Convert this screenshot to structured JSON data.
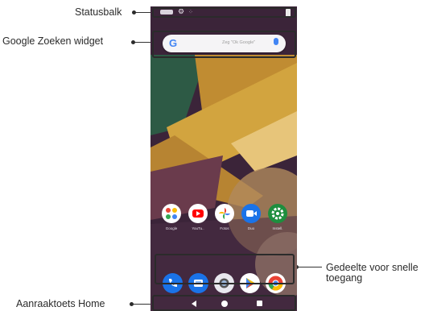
{
  "callouts": {
    "statusbar": "Statusbalk",
    "google_widget": "Google Zoeken widget",
    "quick_access": "Gedeelte voor snelle toegang",
    "home_touch_keys": "Aanraaktoets Home"
  },
  "search_widget": {
    "logo": "G",
    "placeholder": "Zeg \"Ok Google\""
  },
  "apps": [
    {
      "label": "Google",
      "icon": "google-folder-icon",
      "color": "#ffffff"
    },
    {
      "label": "YouTu..",
      "icon": "youtube-icon",
      "color": "#ff0000"
    },
    {
      "label": "Fotos",
      "icon": "google-photos-icon",
      "color": "#ffffff"
    },
    {
      "label": "Duo",
      "icon": "duo-icon",
      "color": "#1a73e8"
    },
    {
      "label": "Instell.",
      "icon": "settings-icon",
      "color": "#1e8e3e"
    }
  ],
  "dock": [
    {
      "icon": "phone-icon",
      "color": "#1a73e8"
    },
    {
      "icon": "messages-icon",
      "color": "#1a73e8"
    },
    {
      "icon": "camera-icon",
      "color": "#e8e8ee"
    },
    {
      "icon": "play-store-icon",
      "color": "#ffffff"
    },
    {
      "icon": "chrome-icon",
      "color": "#ffffff"
    }
  ],
  "nav": {
    "back": "back-icon",
    "home": "home-icon",
    "recents": "recents-icon"
  },
  "colors": {
    "accent": "#4285f4",
    "callout": "#2b2b2b"
  }
}
